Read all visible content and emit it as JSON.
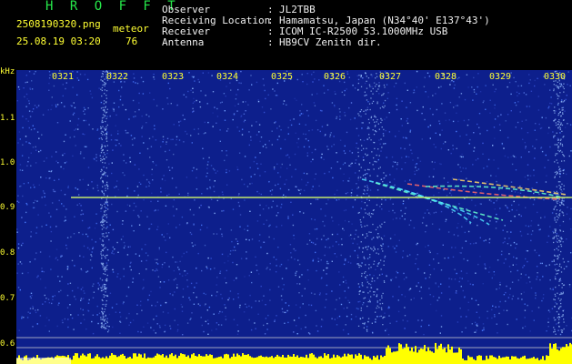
{
  "header": {
    "brand": "H R O F F T",
    "filename": "2508190320.png",
    "timestamp": "25.08.19 03:20",
    "meteor_label": "meteor",
    "meteor_count": "76",
    "fields": [
      {
        "label": "Observer",
        "value": "JL2TBB"
      },
      {
        "label": "Receiving Location",
        "value": "Hamamatsu, Japan (N34°40' E137°43')"
      },
      {
        "label": "Receiver",
        "value": "ICOM IC-R2500 53.1000MHz USB"
      },
      {
        "label": "Antenna",
        "value": "HB9CV Zenith dir."
      }
    ]
  },
  "axis": {
    "y_unit": "kHz",
    "y_ticks": [
      "1.1",
      "1.0",
      "0.9",
      "0.8",
      "0.7",
      "0.6"
    ],
    "x_ticks": [
      "0321",
      "0322",
      "0323",
      "0324",
      "0325",
      "0326",
      "0327",
      "0328",
      "0329",
      "0330"
    ]
  },
  "colors": {
    "background": "#0d1f8c",
    "carrier": "#d8ff6a",
    "amplitude": "#ffff00",
    "label": "#ffff33",
    "brand": "#26e84a"
  }
}
